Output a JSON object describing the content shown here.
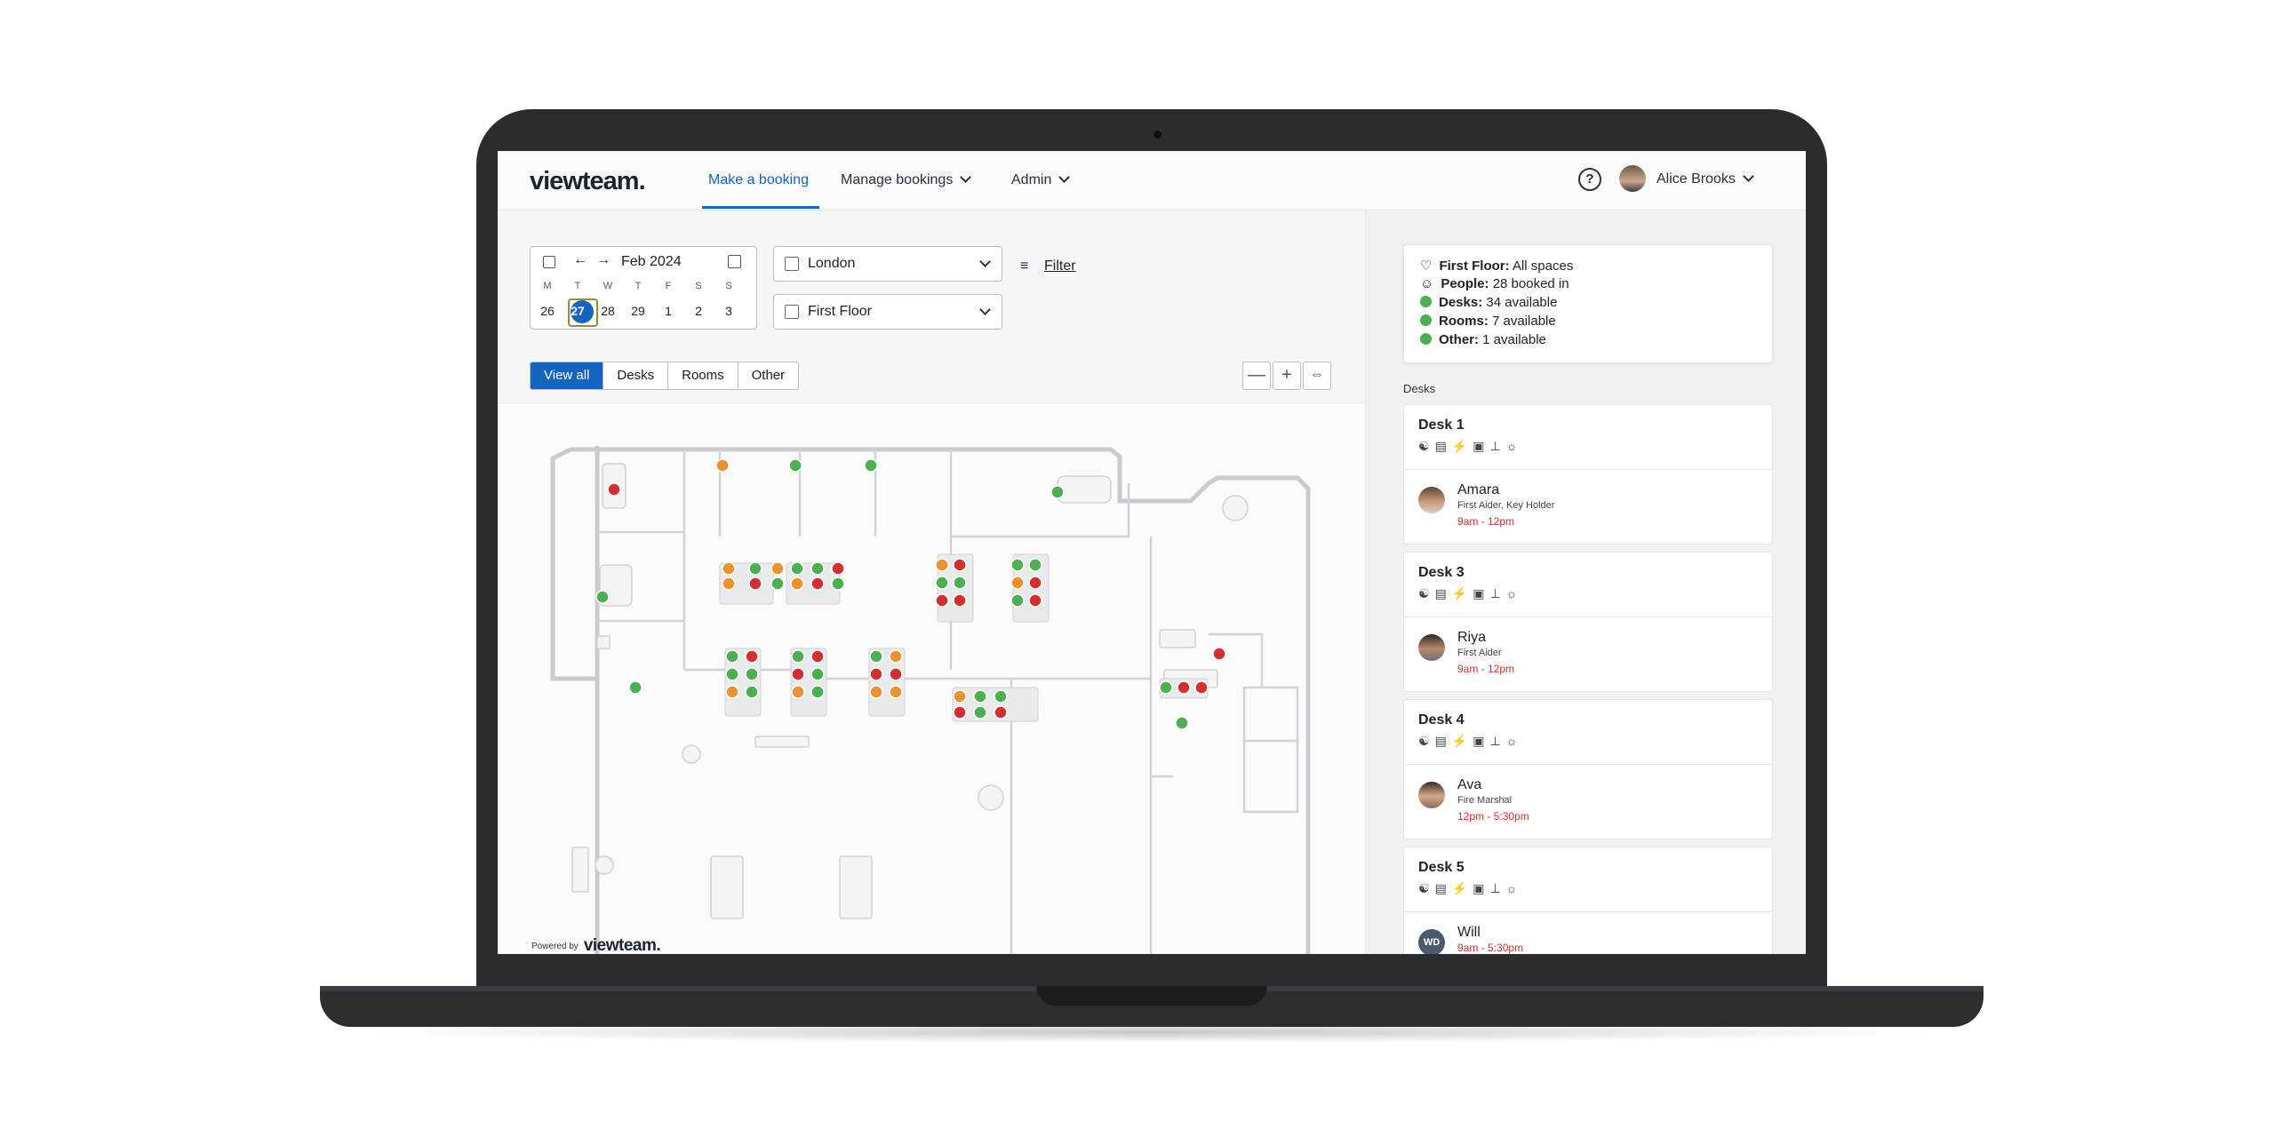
{
  "app": {
    "logo": "viewteam.",
    "help_label": "?"
  },
  "nav": {
    "make_booking": "Make a booking",
    "manage_bookings": "Manage bookings",
    "admin": "Admin",
    "user_name": "Alice Brooks"
  },
  "calendar": {
    "month_label": "Feb 2024",
    "weekdays": [
      "M",
      "T",
      "W",
      "T",
      "F",
      "S",
      "S"
    ],
    "days": [
      "26",
      "27",
      "28",
      "29",
      "1",
      "2",
      "3"
    ],
    "selected_day": "27"
  },
  "location": {
    "selected": "London"
  },
  "floor": {
    "selected": "First Floor"
  },
  "filter_label": "Filter",
  "view_tabs": [
    "View all",
    "Desks",
    "Rooms",
    "Other"
  ],
  "view_tabs_active": "View all",
  "zoom": {
    "out": "—",
    "in": "+",
    "fit": "⇔"
  },
  "powered_by": {
    "label": "Powered by",
    "brand": "viewteam."
  },
  "summary": {
    "floor_label": "First Floor:",
    "floor_value": "All spaces",
    "people_label": "People:",
    "people_value": "28 booked in",
    "desks_label": "Desks:",
    "desks_value": "34 available",
    "rooms_label": "Rooms:",
    "rooms_value": "7 available",
    "other_label": "Other:",
    "other_value": "1 available",
    "available_color": "#4caf50"
  },
  "desks_heading": "Desks",
  "desks": [
    {
      "name": "Desk 1",
      "person": "Amara",
      "roles": "First Aider, Key Holder",
      "time": "9am - 12pm"
    },
    {
      "name": "Desk 3",
      "person": "Riya",
      "roles": "First Aider",
      "time": "9am - 12pm"
    },
    {
      "name": "Desk 4",
      "person": "Ava",
      "roles": "Fire Marshal",
      "time": "12pm - 5:30pm"
    },
    {
      "name": "Desk 5",
      "person": "Will",
      "initials": "WD",
      "roles": "",
      "time": "9am - 5:30pm"
    }
  ],
  "desk_amenity_icons": [
    "people-icon",
    "monitor-port-icon",
    "power-icon",
    "screen-icon",
    "desk-height-icon",
    "wifi-icon"
  ],
  "status_colors": {
    "available": "#4caf50",
    "booked": "#d32f2f",
    "partial": "#f0912f"
  }
}
